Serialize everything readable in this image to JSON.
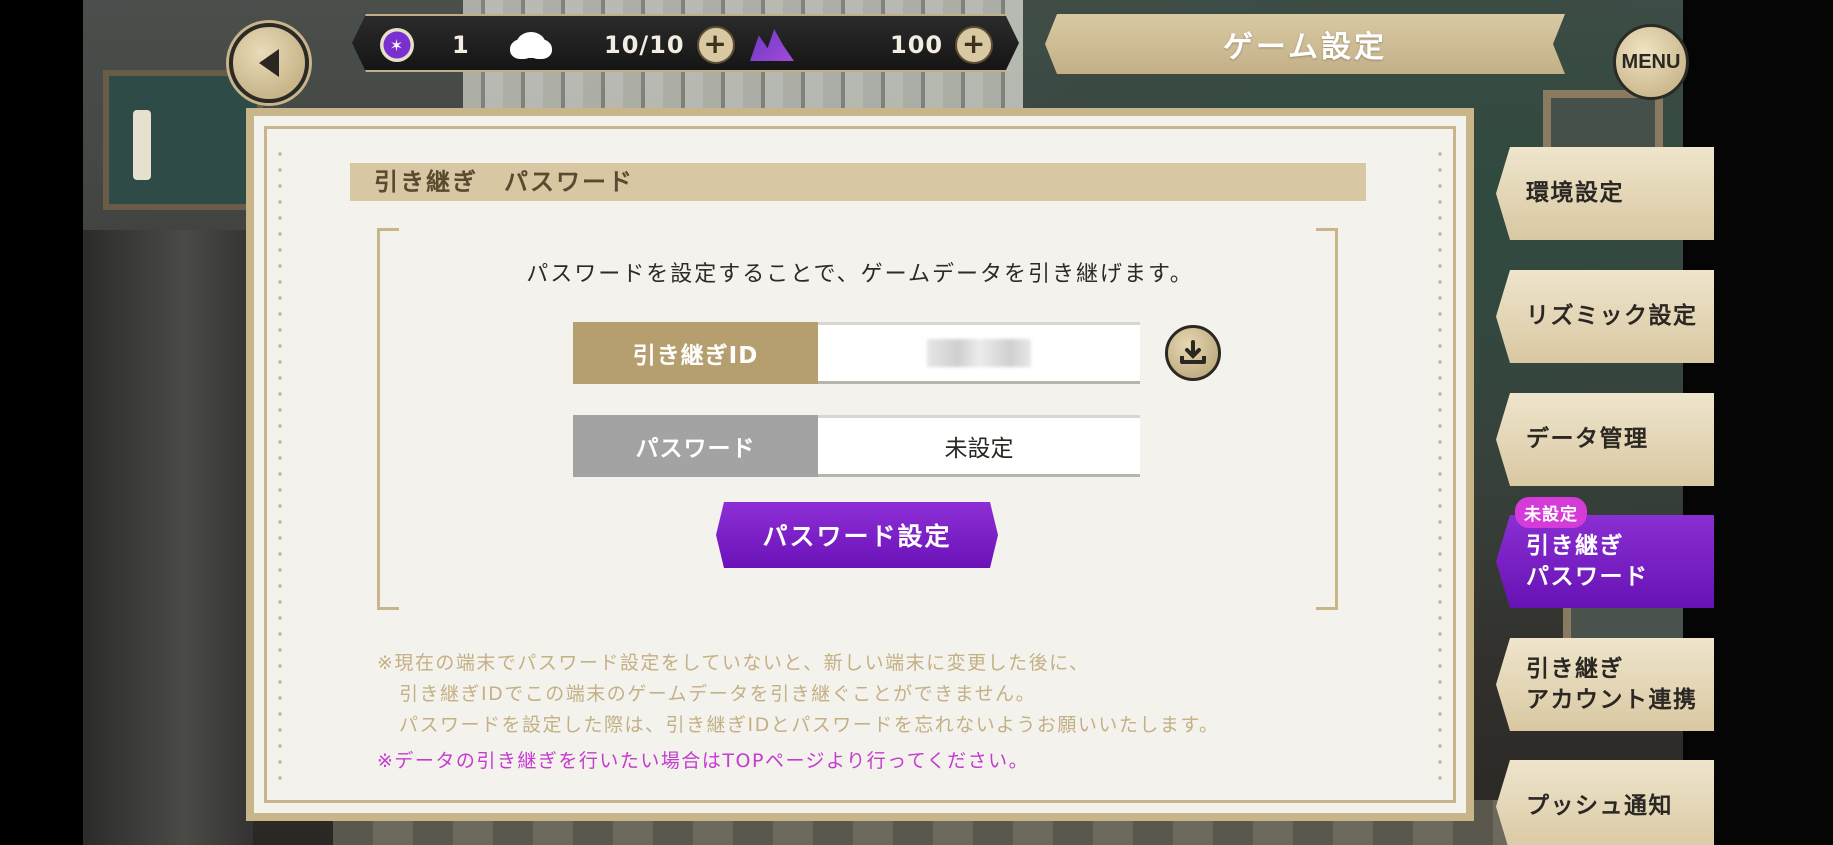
{
  "header": {
    "title": "ゲーム設定",
    "menu_label": "MENU",
    "currencies": [
      {
        "icon": "star-gem-icon",
        "value": "1"
      },
      {
        "icon": "cloud-icon",
        "value": "10/10"
      },
      {
        "icon": "crystal-icon",
        "value": "100"
      }
    ],
    "plus_label": "+"
  },
  "panel": {
    "section_title": "引き継ぎ　パスワード",
    "description": "パスワードを設定することで、ゲームデータを引き継げます。",
    "id_label": "引き継ぎID",
    "password_label": "パスワード",
    "password_value": "未設定",
    "set_password_button": "パスワード設定",
    "notes": [
      "※現在の端末でパスワード設定をしていないと、新しい端末に変更した後に、",
      "引き継ぎIDでこの端末のゲームデータを引き継ぐことができません。",
      "パスワードを設定した際は、引き継ぎIDとパスワードを忘れないようお願いいたします。"
    ],
    "warning": "※データの引き継ぎを行いたい場合はTOPページより行ってください。"
  },
  "sidebar": {
    "tabs": [
      {
        "line1": "環境設定",
        "line2": ""
      },
      {
        "line1": "リズミック設定",
        "line2": ""
      },
      {
        "line1": "データ管理",
        "line2": ""
      },
      {
        "line1": "引き継ぎ",
        "line2": "パスワード",
        "badge": "未設定",
        "active": true
      },
      {
        "line1": "引き継ぎ",
        "line2": "アカウント連携"
      },
      {
        "line1": "プッシュ通知",
        "line2": ""
      }
    ]
  },
  "colors": {
    "accent_purple": "#7a1fc6",
    "gold": "#c8b58a",
    "badge_pink": "#d43bd8",
    "warning_text": "#c43bd0"
  }
}
